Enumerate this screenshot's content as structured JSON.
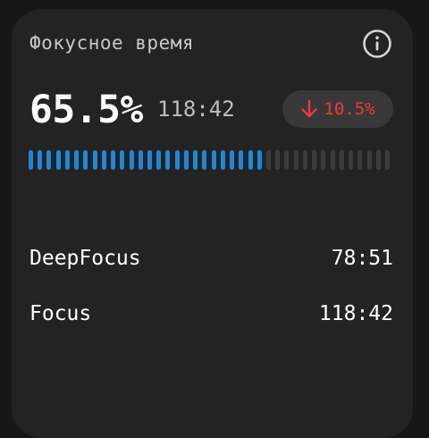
{
  "card": {
    "title": "Фокусное время",
    "percent": "65.5%",
    "total_time": "118:42",
    "change": {
      "direction": "down",
      "text": "10.5%",
      "color": "#ef3b3b"
    },
    "progress": {
      "fraction": 0.655,
      "total_ticks": 40,
      "filled_color": "#1e88d8",
      "empty_color": "#3c3c3c"
    },
    "rows": [
      {
        "label": "DeepFocus",
        "value": "78:51"
      },
      {
        "label": "Focus",
        "value": "118:42"
      }
    ],
    "icons": {
      "info": "info-icon",
      "arrow": "arrow-down-icon"
    }
  }
}
